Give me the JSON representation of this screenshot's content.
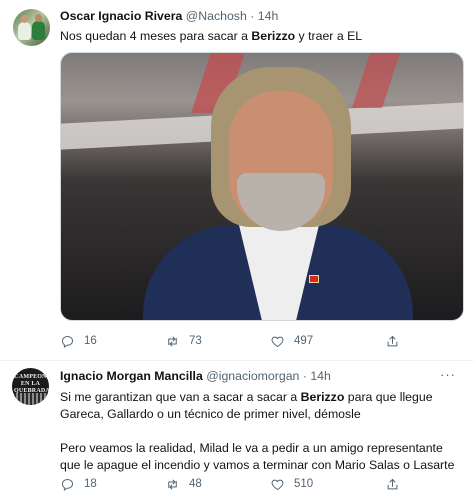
{
  "tweets": [
    {
      "display_name": "Oscar Ignacio Rivera",
      "handle": "@Nachosh",
      "separator": "·",
      "time": "14h",
      "text": {
        "part1": "Nos quedan 4 meses para sacar a ",
        "bold1": "Berizzo",
        "part2": " y traer a EL"
      },
      "counts": {
        "replies": "16",
        "retweets": "73",
        "likes": "497"
      }
    },
    {
      "display_name": "Ignacio Morgan Mancilla",
      "handle": "@ignaciomorgan",
      "separator": "·",
      "time": "14h",
      "more": "···",
      "avatar_text": "CAMPEON EN LA QUEBRADA",
      "text": {
        "part1": "Si me garantizan que van a sacar a sacar a ",
        "bold1": "Berizzo",
        "part2": " para que llegue Gareca, Gallardo o un técnico de primer nivel, démosle",
        "para2": "Pero veamos la realidad, Milad le va a pedir a un amigo representante que le apague el incendio y vamos a terminar con Mario Salas o Lasarte"
      },
      "counts": {
        "replies": "18",
        "retweets": "48",
        "likes": "510"
      }
    }
  ],
  "icons": {
    "reply": "reply-icon",
    "retweet": "retweet-icon",
    "like": "heart-icon",
    "share": "share-icon"
  },
  "colors": {
    "text": "#0f1419",
    "secondary": "#536471",
    "divider": "#eff3f4"
  }
}
